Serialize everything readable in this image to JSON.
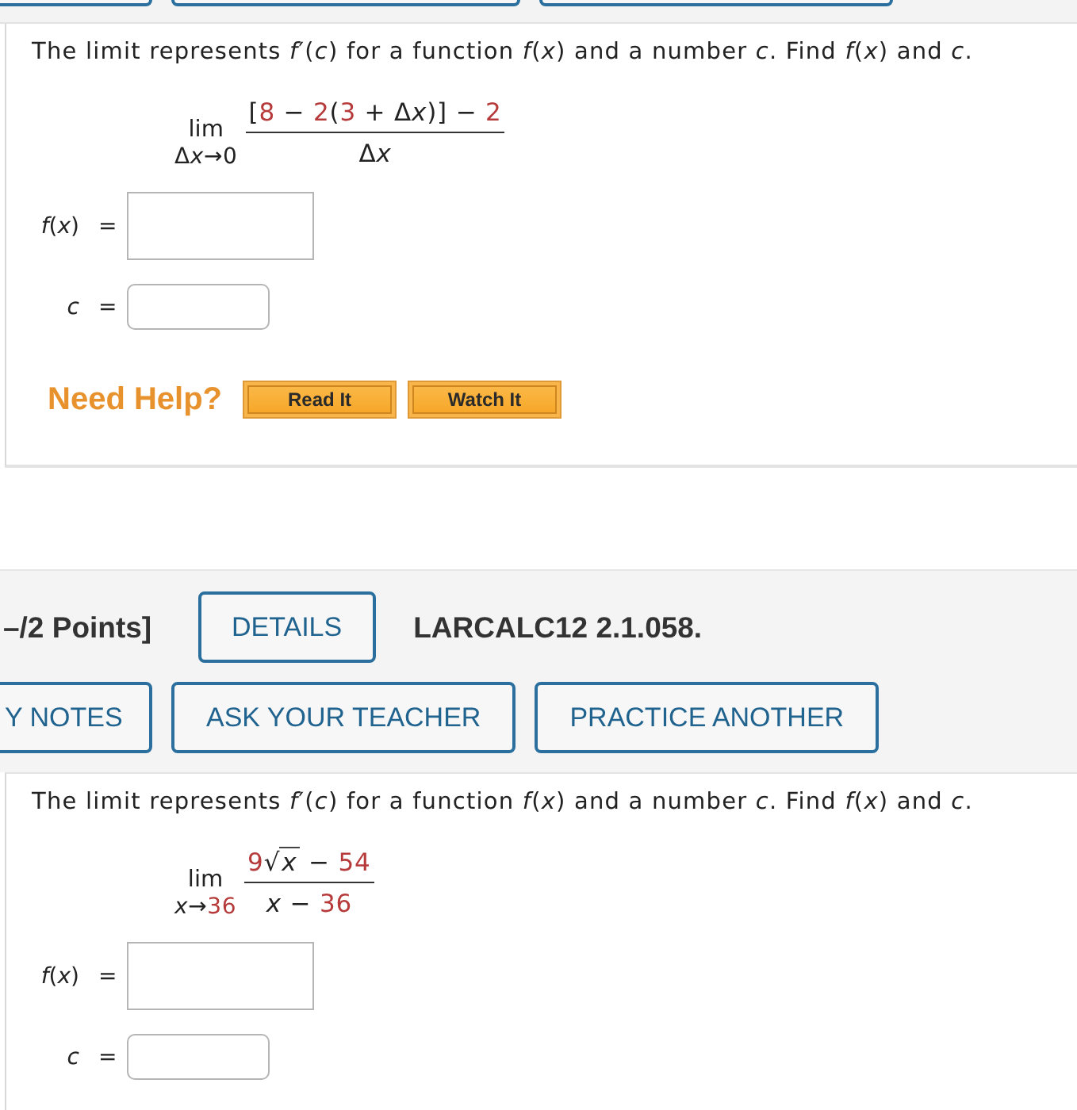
{
  "previous_question": {
    "prompt": "The limit represents *f*′(*c*) for a function *f*(*x*) and a number *c*. Find *f*(*x*) and *c*.",
    "limit": {
      "operator": "lim",
      "approach": [
        {
          "kind": "sym",
          "text": "Δ"
        },
        {
          "kind": "var",
          "text": "x"
        },
        {
          "kind": "sym",
          "text": "→0"
        }
      ],
      "numerator": [
        {
          "kind": "sym",
          "text": "["
        },
        {
          "kind": "num",
          "text": "8"
        },
        {
          "kind": "sym",
          "text": " − "
        },
        {
          "kind": "num",
          "text": "2"
        },
        {
          "kind": "sym",
          "text": "("
        },
        {
          "kind": "num",
          "text": "3"
        },
        {
          "kind": "sym",
          "text": " + Δ"
        },
        {
          "kind": "var",
          "text": "x"
        },
        {
          "kind": "sym",
          "text": ")] − "
        },
        {
          "kind": "num",
          "text": "2"
        }
      ],
      "denominator": [
        {
          "kind": "sym",
          "text": "Δ"
        },
        {
          "kind": "var",
          "text": "x"
        }
      ]
    },
    "answers": [
      {
        "kind": "expression",
        "label": [
          {
            "kind": "var",
            "text": "f"
          },
          {
            "kind": "sym",
            "text": "("
          },
          {
            "kind": "var",
            "text": "x"
          },
          {
            "kind": "sym",
            "text": ")"
          }
        ],
        "equals": "="
      },
      {
        "kind": "number",
        "label": [
          {
            "kind": "var",
            "text": "c"
          }
        ],
        "equals": "="
      }
    ],
    "help": {
      "title": "Need Help?",
      "buttons": [
        "Read It",
        "Watch It"
      ]
    }
  },
  "question_header": {
    "points": "–/2 Points]",
    "details_button": "DETAILS",
    "code": "LARCALC12 2.1.058.",
    "buttons": [
      "Y NOTES",
      "ASK YOUR TEACHER",
      "PRACTICE ANOTHER"
    ]
  },
  "question": {
    "prompt": "The limit represents *f*′(*c*) for a function *f*(*x*) and a number *c*. Find *f*(*x*) and *c*.",
    "limit": {
      "operator": "lim",
      "approach": [
        {
          "kind": "var",
          "text": "x"
        },
        {
          "kind": "sym",
          "text": "→"
        },
        {
          "kind": "num",
          "text": "36"
        }
      ],
      "numerator": [
        {
          "kind": "num",
          "text": "9"
        },
        {
          "kind": "root",
          "text": "√"
        },
        {
          "kind": "radicand",
          "text": "x"
        },
        {
          "kind": "sym",
          "text": " − "
        },
        {
          "kind": "num",
          "text": "54"
        }
      ],
      "denominator": [
        {
          "kind": "var",
          "text": "x"
        },
        {
          "kind": "sym",
          "text": " − "
        },
        {
          "kind": "num",
          "text": "36"
        }
      ]
    },
    "answers": [
      {
        "kind": "expression",
        "label": [
          {
            "kind": "var",
            "text": "f"
          },
          {
            "kind": "sym",
            "text": "("
          },
          {
            "kind": "var",
            "text": "x"
          },
          {
            "kind": "sym",
            "text": ")"
          }
        ],
        "equals": "="
      },
      {
        "kind": "number",
        "label": [
          {
            "kind": "var",
            "text": "c"
          }
        ],
        "equals": "="
      }
    ]
  }
}
